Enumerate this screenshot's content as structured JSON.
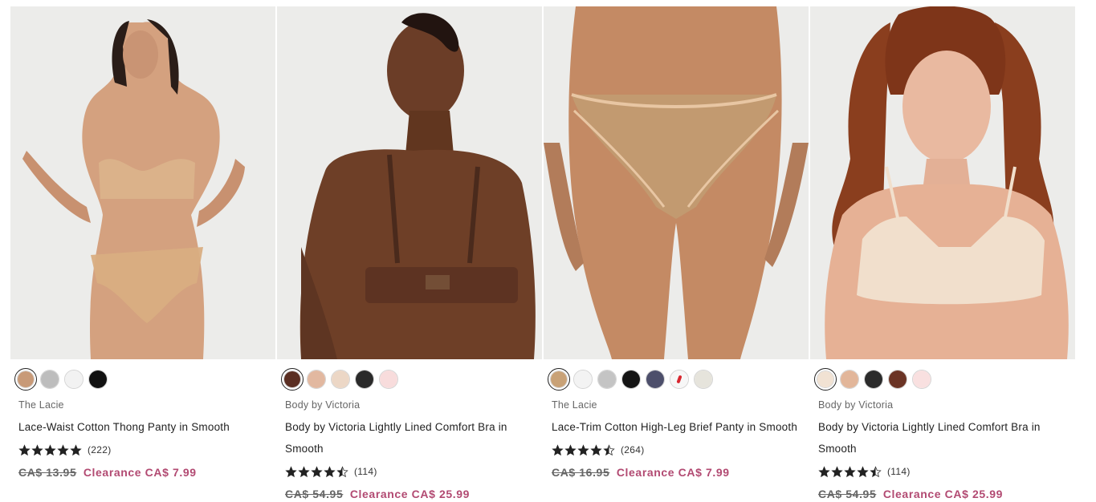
{
  "products": [
    {
      "brand": "The Lacie",
      "name": "Lace-Waist Cotton Thong Panty in Smooth",
      "rating_value": 5,
      "review_count": "(222)",
      "original_price": "CA$ 13.95",
      "clearance_label": "Clearance CA$ 7.99",
      "swatches": [
        "#c89a78",
        "#bdbdbd",
        "#f2f2f2",
        "#111111"
      ]
    },
    {
      "brand": "Body by Victoria",
      "name": "Body by Victoria Lightly Lined Comfort Bra in Smooth",
      "rating_value": 4.5,
      "review_count": "(114)",
      "original_price": "CA$ 54.95",
      "clearance_label": "Clearance CA$ 25.99",
      "swatches": [
        "#5a2e22",
        "#e2b8a0",
        "#ecd7c6",
        "#2a2a2a",
        "#f8dcdc"
      ]
    },
    {
      "brand": "The Lacie",
      "name": "Lace-Trim Cotton High-Leg Brief Panty in Smooth",
      "rating_value": 4.5,
      "review_count": "(264)",
      "original_price": "CA$ 16.95",
      "clearance_label": "Clearance CA$ 7.99",
      "swatches": [
        "#c9a277",
        "#f3f3f3",
        "#c4c4c4",
        "#141414",
        "#4d4f6b",
        "#f7f7f7",
        "#e6e4dc"
      ]
    },
    {
      "brand": "Body by Victoria",
      "name": "Body by Victoria Lightly Lined Comfort Bra in Smooth",
      "rating_value": 4.5,
      "review_count": "(114)",
      "original_price": "CA$ 54.95",
      "clearance_label": "Clearance CA$ 25.99",
      "swatches": [
        "#f1e2d3",
        "#e2b69a",
        "#2b2b2b",
        "#6b3425",
        "#f9e0e0"
      ]
    }
  ],
  "colors": {
    "clearance": "#b24a72",
    "photo_bg": "#ececea"
  },
  "icons": {
    "star": "star-icon",
    "half_star": "half-star-icon"
  }
}
